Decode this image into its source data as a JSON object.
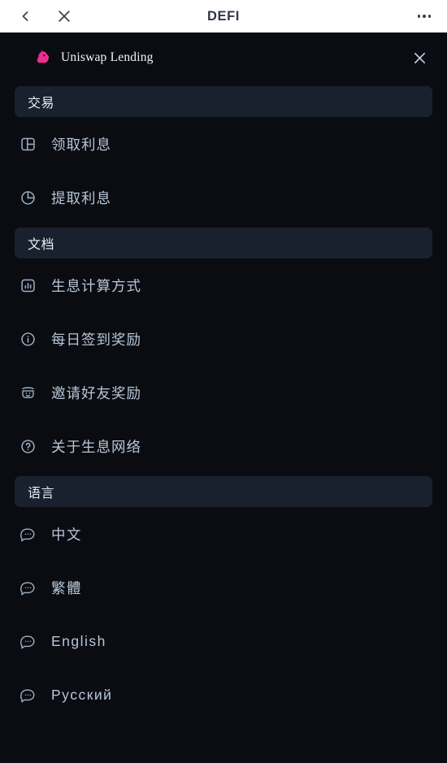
{
  "topbar": {
    "back_icon": "chevron-left-icon",
    "close_icon": "close-icon",
    "title": "DEFI",
    "more_icon": "more-horizontal-icon"
  },
  "panel": {
    "brand_name": "Uniswap Lending",
    "brand_logo_icon": "uniswap-unicorn-logo",
    "close_icon": "close-icon",
    "accent_color": "#ec2e8f",
    "background_color": "#0a0c12",
    "section_header_color": "#19212e",
    "text_color": "#b9c6d8"
  },
  "sections": [
    {
      "title": "交易",
      "items": [
        {
          "label": "领取利息",
          "icon": "panel-layout-icon"
        },
        {
          "label": "提取利息",
          "icon": "pie-chart-icon"
        }
      ]
    },
    {
      "title": "文档",
      "items": [
        {
          "label": "生息计算方式",
          "icon": "bar-chart-icon"
        },
        {
          "label": "每日签到奖励",
          "icon": "info-circle-icon"
        },
        {
          "label": "邀请好友奖励",
          "icon": "smiley-face-icon"
        },
        {
          "label": "关于生息网络",
          "icon": "question-circle-icon"
        }
      ]
    },
    {
      "title": "语言",
      "items": [
        {
          "label": "中文",
          "icon": "chat-bubble-icon"
        },
        {
          "label": "繁體",
          "icon": "chat-bubble-icon"
        },
        {
          "label": "English",
          "icon": "chat-bubble-icon"
        },
        {
          "label": "Русский",
          "icon": "chat-bubble-icon"
        }
      ]
    }
  ]
}
